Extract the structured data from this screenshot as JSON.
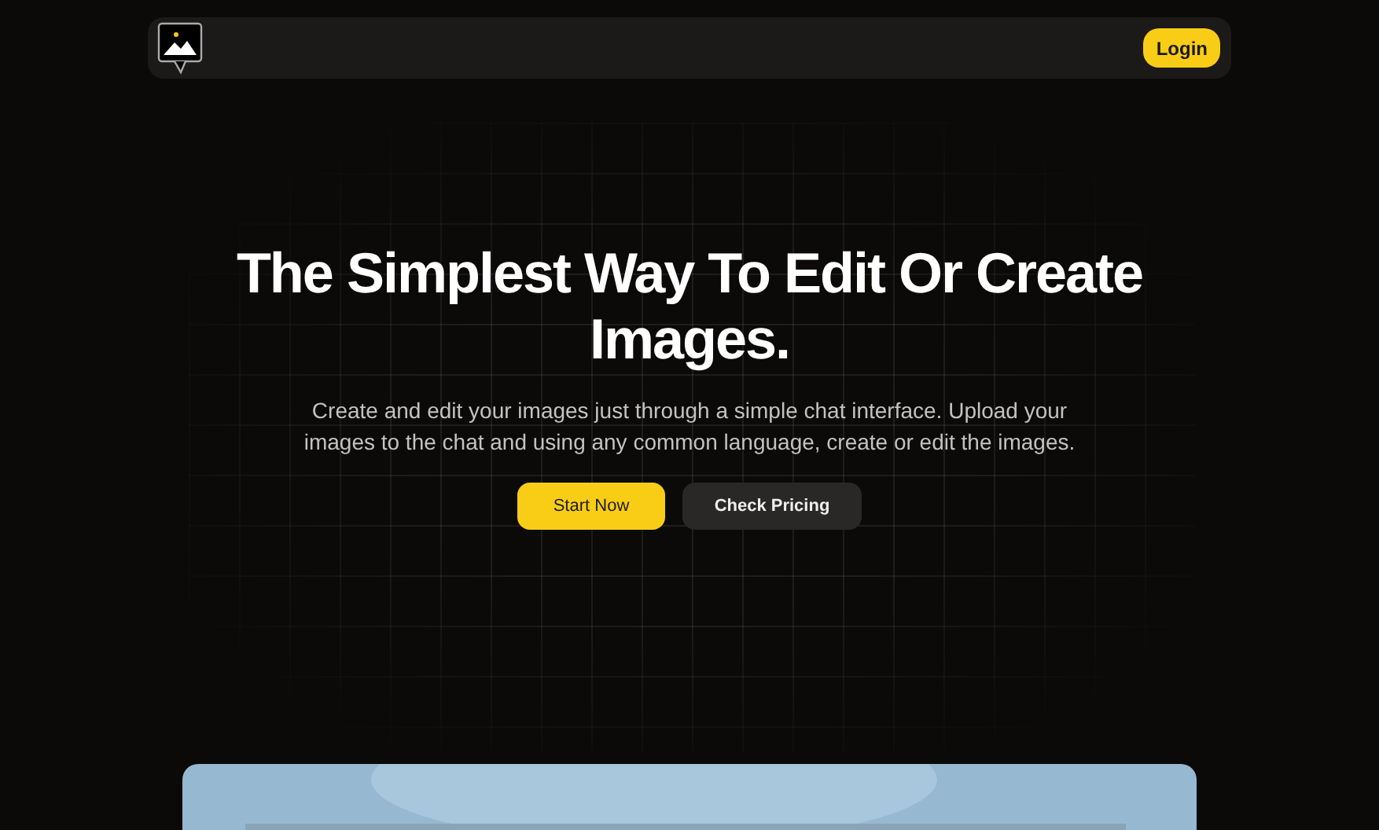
{
  "nav": {
    "login": "Login"
  },
  "hero": {
    "heading": "The Simplest Way To Edit Or Create Images.",
    "description": "Create and edit your images just through a simple chat interface. Upload your images to the chat and using any common language, create or edit the images.",
    "buttons": [
      {
        "label": "Start Now",
        "kind": "primary"
      },
      {
        "label": "Check Pricing",
        "kind": "secondary"
      }
    ]
  }
}
